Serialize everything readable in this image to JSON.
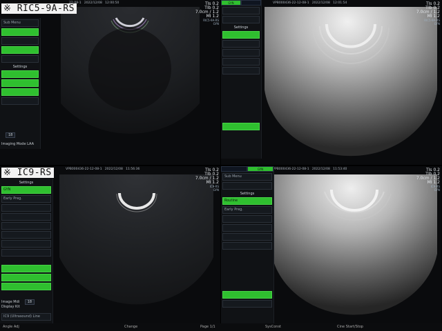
{
  "labels": {
    "top": "※ RIC5-9A-RS",
    "bottom": "※ IC9-RS"
  },
  "q1": {
    "header": {
      "id": "22-08-1",
      "date": "2022/12/08",
      "time": "12:00:50"
    },
    "info": {
      "tis": "TIs 0.2",
      "tib": "TIb 0.2",
      "depth": "7.0cm / 1.2",
      "mi": "MI 1.2",
      "probe": "RIC5-9A-RS",
      "preset": "GYN"
    },
    "panel": [
      "Sub Menu",
      "",
      "",
      "",
      "",
      "Settings",
      "",
      "",
      "",
      "",
      "",
      ""
    ],
    "footer_value": "18",
    "footer_label": "Imaging Mode",
    "footer_value2": "LAA"
  },
  "q2": {
    "header": {
      "id": "VPB000436-22-12-08-1",
      "date": "2022/12/08",
      "time": "12:01:54"
    },
    "info": {
      "tis": "TIs 0.2",
      "tib": "TIb 0.2",
      "depth": "7.0cm / 1.2",
      "mi": "MI 1.2",
      "probe": "RIC5-9A-RS",
      "preset": "GYN"
    },
    "tabs": [
      "GYN",
      ""
    ],
    "panel": [
      "",
      "",
      "Settings",
      "",
      "",
      "",
      "",
      ""
    ]
  },
  "q3": {
    "header": {
      "id": "VPB000436-22-12-08-1",
      "date": "2022/12/08",
      "time": "11:56:36"
    },
    "info": {
      "tis": "TIs 0.2",
      "tib": "TIb 0.2",
      "depth": "7.0cm / 1.2",
      "mi": "MI 1.2",
      "probe": "IC9-RS",
      "preset": "GYN"
    },
    "tabs": [
      "",
      "GYN"
    ],
    "panel_title": "Settings",
    "panel": [
      "GYN",
      "Early Preg.",
      "",
      "",
      "",
      "",
      "",
      "",
      "",
      "",
      "",
      "",
      "",
      ""
    ],
    "footer_label": "Image Mdi",
    "footer_value": "18",
    "footer2": "Display Kit",
    "footer3": "IC9 (Ultrasound) Line",
    "status": [
      "Angle Adj",
      "",
      "Change",
      "",
      "Page 1/1"
    ]
  },
  "q4": {
    "header": {
      "id": "VPB000436-22-12-08-1",
      "date": "2022/12/08",
      "time": "11:53:40"
    },
    "info": {
      "tis": "TIs 0.2",
      "tib": "TIb 0.2",
      "depth": "7.0cm / 1.2",
      "mi": "MI 1.2",
      "probe": "IC9-RS",
      "preset": "GYN"
    },
    "tabs": [
      "",
      "GYN"
    ],
    "panel_title": "Settings",
    "panel": [
      "Sub Menu",
      "",
      "Settings",
      "Routine",
      "Early Preg.",
      "",
      "",
      "",
      "",
      "",
      ""
    ],
    "status": [
      "SysConst",
      "Cine Start/Stop"
    ]
  },
  "colors": {
    "accent_green": "#2fbf2f",
    "info_blue": "#4a7bff",
    "label_bg": "#f2f2f2"
  }
}
